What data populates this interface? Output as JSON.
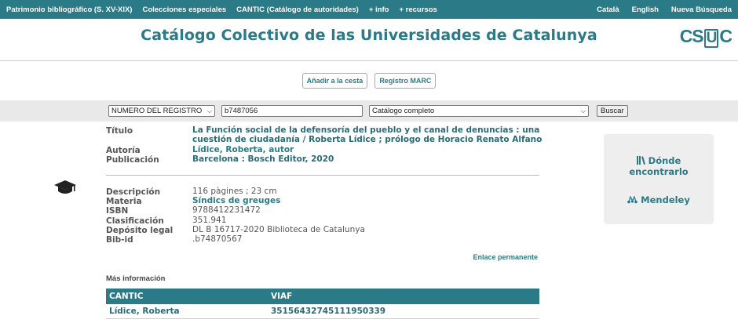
{
  "topnav": {
    "left": [
      "Patrimonio bibliográfico (S. XV-XIX)",
      "Colecciones especiales",
      "CANTIC (Catálogo de autoridades)",
      "+ info",
      "+ recursos"
    ],
    "right": [
      "Català",
      "English",
      "Nueva Búsqueda"
    ]
  },
  "header": {
    "title": "Catálogo Colectivo de las Universidades de Catalunya",
    "logo_pre": "CS",
    "logo_box": "U",
    "logo_post": "C"
  },
  "actions": {
    "add_to_basket": "Añadir a la cesta",
    "marc_record": "Registro MARC"
  },
  "search": {
    "field_select": "NUMERO DEL REGISTRO",
    "query": "b7487056",
    "catalog_select": "Catálogo completo",
    "button": "Buscar"
  },
  "record": {
    "title_label": "Título",
    "title_line1": "La Función social de la defensoría del pueblo y el canal de denuncias : una",
    "title_line2": "cuestión de ciudadanía / Roberta Lídice ; prólogo de Horacio Renato Alfano",
    "author_label": "Autoría",
    "author": "Lídice, Roberta, autor",
    "publication_label": "Publicación",
    "publication": "Barcelona : Bosch Editor, 2020",
    "description_label": "Descripción",
    "description": "116 pàgines ; 23 cm",
    "subject_label": "Materia",
    "subject": "Síndics de greuges",
    "isbn_label": "ISBN",
    "isbn": "9788412231472",
    "classification_label": "Clasificación",
    "classification": "351.941",
    "legal_deposit_label": "Depósito legal",
    "legal_deposit": "DL B 16717-2020 Biblioteca de Catalunya",
    "bibid_label": "Bib-id",
    "bibid": ".b74870567"
  },
  "permalink": "Enlace permanente",
  "more_info": {
    "heading": "Más información",
    "col_cantic": "CANTIC",
    "col_viaf": "VIAF",
    "cantic_value": "Lídice, Roberta",
    "viaf_value": "35156432745111950339"
  },
  "sidebox": {
    "where_line1": "Dónde",
    "where_line2": "encontrarlo",
    "mendeley": "Mendeley"
  },
  "colors": {
    "accent": "#2a7a87",
    "searchbar_bg": "#e9e9e9",
    "sidebox_bg": "#eeeeee"
  },
  "icons": {
    "material_type": "graduation-cap-icon",
    "where": "books-icon",
    "mendeley": "mendeley-icon"
  }
}
